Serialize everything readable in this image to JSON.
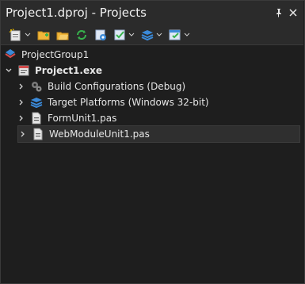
{
  "window": {
    "title": "Project1.dproj - Projects",
    "pin_icon": "pin-icon",
    "close_icon": "close-icon"
  },
  "toolbar": {
    "buttons": [
      "new-item-icon",
      "add-folder-icon",
      "open-folder-icon",
      "sync-icon",
      "build-config-icon",
      "check-dropdown-icon",
      "platforms-dropdown-icon",
      "deploy-dropdown-icon"
    ]
  },
  "tree": {
    "group": {
      "label": "ProjectGroup1",
      "icon": "project-group-icon"
    },
    "project": {
      "label": "Project1.exe",
      "icon": "exe-project-icon"
    },
    "children": [
      {
        "label": "Build Configurations (Debug)",
        "icon": "gears-icon"
      },
      {
        "label": "Target Platforms (Windows 32-bit)",
        "icon": "layers-icon"
      },
      {
        "label": "FormUnit1.pas",
        "icon": "pas-file-icon"
      },
      {
        "label": "WebModuleUnit1.pas",
        "icon": "pas-file-icon"
      }
    ]
  },
  "colors": {
    "background": "#1e1e1e",
    "titlebar": "#2b2b2b",
    "selection": "#2f2f2f",
    "accent_blue": "#3b8ad9",
    "accent_green": "#37b24d"
  }
}
